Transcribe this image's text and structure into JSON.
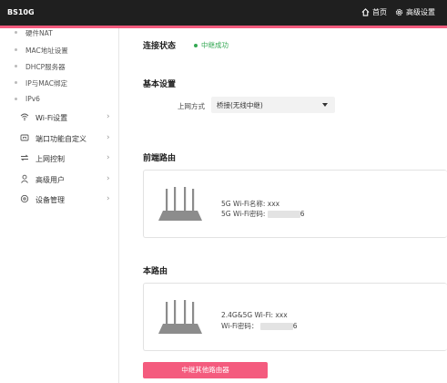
{
  "header": {
    "model": "BS10G",
    "home_label": "首页",
    "advanced_label": "高级设置",
    "accent_color": "#f45b7e"
  },
  "sidebar": {
    "subitems": [
      "硬件NAT",
      "MAC地址设置",
      "DHCP服务器",
      "IP与MAC绑定",
      "IPv6"
    ],
    "menu": [
      {
        "label": "Wi-Fi设置",
        "icon": "wifi-icon"
      },
      {
        "label": "端口功能自定义",
        "icon": "port-icon"
      },
      {
        "label": "上网控制",
        "icon": "transfer-icon"
      },
      {
        "label": "高级用户",
        "icon": "user-icon"
      },
      {
        "label": "设备管理",
        "icon": "gear-icon"
      }
    ]
  },
  "main": {
    "connection_status_title": "连接状态",
    "connection_status_value": "中继成功",
    "basic_settings_title": "基本设置",
    "internet_mode_label": "上网方式",
    "internet_mode_value": "桥接(无线中继)",
    "upstream_title": "前端路由",
    "upstream_ssid_label": "5G Wi-Fi名称: xxx",
    "upstream_pwd_label": "5G Wi-Fi密码:",
    "upstream_pwd_tail": "6",
    "this_router_title": "本路由",
    "this_ssid_label": "2.4G&5G Wi-Fi: xxx",
    "this_pwd_label": "Wi-Fi密码：",
    "this_pwd_tail": "6",
    "relay_button": "中继其他路由器"
  }
}
